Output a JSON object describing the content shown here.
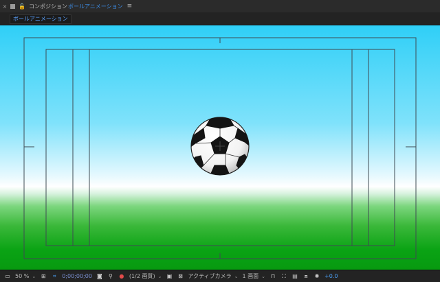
{
  "window": {
    "close_glyph": "×",
    "lock_glyph": "🔓",
    "title_prefix": "コンポジション",
    "composition_name": "ボールアニメーション",
    "menu_glyph": "≡"
  },
  "tab": {
    "label": "ボールアニメーション"
  },
  "viewer": {
    "sky_top_color": "#2fcff7",
    "ground_color": "#0aa314",
    "guide_color": "#3e4a52"
  },
  "statusbar": {
    "zoom": "50 %",
    "timecode": "0;00;00;00",
    "resolution": "(1/2 画質)",
    "camera": "アクティブカメラ",
    "views": "1 画面",
    "exposure": "+0.0"
  }
}
